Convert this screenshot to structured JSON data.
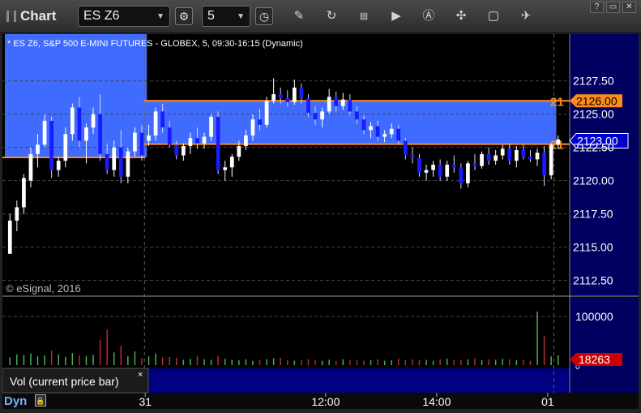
{
  "toolbar": {
    "title": "Chart",
    "symbol": "ES Z6",
    "interval": "5"
  },
  "chart_header": "* ES Z6, S&P 500 E-MINI FUTURES - GLOBEX, 5, 09:30-16:15 (Dynamic)",
  "copyright": "© eSignal, 2016",
  "volume_panel_label": "Vol (current price bar)",
  "volume_panel_close": "×",
  "footer_label": "Dyn",
  "colors": {
    "background": "#000000",
    "axis_bg": "#000060",
    "up": "#ffffff",
    "down": "#1a1aff",
    "zone": "#3f6bff",
    "level_line": "#ff8c1a",
    "vol_up": "#4caf50",
    "vol_down": "#b03030"
  },
  "chart_data": [
    {
      "type": "candlestick",
      "price_axis": {
        "ticks": [
          "2127.50",
          "2125.00",
          "2122.50",
          "2120.00",
          "2117.50",
          "2115.00",
          "2112.50"
        ],
        "ylim": [
          2111.5,
          2129.8
        ]
      },
      "time_axis": {
        "ticks": [
          "31",
          "12:00",
          "14:00",
          "01"
        ]
      },
      "levels": [
        {
          "value": 2126.0,
          "label": "2126.00",
          "edge_label": "21"
        },
        {
          "value": 2122.75,
          "label": "",
          "edge_label": "21"
        }
      ],
      "last_price": {
        "value": 2123.0,
        "label": "2123.00"
      },
      "prior_session_level": 2121.75,
      "zones": [
        {
          "from_bar": 0,
          "to_bar": 19,
          "low": 2121.75,
          "high": 2129.8
        },
        {
          "from_bar": 20,
          "to_bar": 78,
          "low": 2122.75,
          "high": 2126.0
        }
      ],
      "session_breaks": [
        20,
        79
      ],
      "bars": [
        [
          2114.5,
          2117.5,
          2114.5,
          2117.0
        ],
        [
          2117.0,
          2118.5,
          2116.2,
          2118.0
        ],
        [
          2118.0,
          2120.5,
          2117.5,
          2120.2
        ],
        [
          2120.0,
          2122.5,
          2119.5,
          2122.0
        ],
        [
          2122.0,
          2123.5,
          2121.0,
          2122.7
        ],
        [
          2122.7,
          2125.0,
          2122.5,
          2124.5
        ],
        [
          2124.5,
          2124.8,
          2120.2,
          2120.8
        ],
        [
          2120.8,
          2121.8,
          2120.3,
          2121.5
        ],
        [
          2121.5,
          2124.0,
          2121.0,
          2123.5
        ],
        [
          2123.5,
          2125.8,
          2123.0,
          2125.5
        ],
        [
          2125.5,
          2126.3,
          2122.5,
          2123.0
        ],
        [
          2123.0,
          2124.3,
          2121.3,
          2124.0
        ],
        [
          2124.0,
          2125.5,
          2123.5,
          2125.0
        ],
        [
          2125.0,
          2126.5,
          2121.5,
          2122.0
        ],
        [
          2122.0,
          2122.8,
          2120.5,
          2120.8
        ],
        [
          2120.8,
          2123.0,
          2120.3,
          2122.5
        ],
        [
          2122.5,
          2123.8,
          2119.8,
          2120.3
        ],
        [
          2120.3,
          2122.5,
          2119.8,
          2122.2
        ],
        [
          2122.2,
          2124.0,
          2121.8,
          2123.6
        ],
        [
          2123.6,
          2124.2,
          2121.5,
          2121.9
        ],
        [
          2123.0,
          2124.2,
          2122.6,
          2123.4
        ],
        [
          2123.4,
          2125.5,
          2123.0,
          2125.2
        ],
        [
          2125.2,
          2125.8,
          2123.6,
          2124.0
        ],
        [
          2124.0,
          2124.5,
          2122.5,
          2122.7
        ],
        [
          2122.7,
          2123.0,
          2121.6,
          2121.9
        ],
        [
          2121.9,
          2122.8,
          2121.5,
          2122.6
        ],
        [
          2122.6,
          2123.6,
          2122.0,
          2123.2
        ],
        [
          2123.2,
          2124.0,
          2122.4,
          2122.8
        ],
        [
          2122.8,
          2123.6,
          2122.4,
          2123.3
        ],
        [
          2123.3,
          2125.0,
          2123.0,
          2124.8
        ],
        [
          2124.8,
          2125.2,
          2120.5,
          2120.8
        ],
        [
          2120.8,
          2121.5,
          2120.0,
          2121.0
        ],
        [
          2121.0,
          2122.0,
          2120.3,
          2121.8
        ],
        [
          2121.8,
          2123.0,
          2121.5,
          2122.6
        ],
        [
          2122.6,
          2123.8,
          2122.3,
          2123.4
        ],
        [
          2123.4,
          2125.0,
          2123.0,
          2124.6
        ],
        [
          2124.6,
          2125.4,
          2123.8,
          2124.2
        ],
        [
          2124.2,
          2126.3,
          2124.0,
          2126.0
        ],
        [
          2126.0,
          2127.7,
          2125.8,
          2126.5
        ],
        [
          2126.5,
          2127.0,
          2125.8,
          2126.2
        ],
        [
          2126.2,
          2126.8,
          2125.6,
          2125.9
        ],
        [
          2125.9,
          2127.6,
          2125.7,
          2127.0
        ],
        [
          2127.0,
          2127.3,
          2125.8,
          2126.2
        ],
        [
          2126.2,
          2126.5,
          2124.8,
          2125.1
        ],
        [
          2125.1,
          2125.6,
          2124.2,
          2124.6
        ],
        [
          2124.6,
          2125.5,
          2124.0,
          2125.2
        ],
        [
          2125.2,
          2126.9,
          2125.0,
          2126.3
        ],
        [
          2126.3,
          2126.7,
          2125.2,
          2125.6
        ],
        [
          2125.6,
          2126.6,
          2125.3,
          2126.1
        ],
        [
          2126.1,
          2126.5,
          2124.9,
          2125.2
        ],
        [
          2125.2,
          2125.6,
          2124.3,
          2124.6
        ],
        [
          2124.6,
          2124.9,
          2123.5,
          2123.8
        ],
        [
          2123.8,
          2124.4,
          2123.2,
          2124.1
        ],
        [
          2124.1,
          2124.5,
          2123.0,
          2123.3
        ],
        [
          2123.3,
          2123.8,
          2122.9,
          2123.5
        ],
        [
          2123.5,
          2124.3,
          2123.2,
          2123.9
        ],
        [
          2123.9,
          2124.2,
          2122.7,
          2123.0
        ],
        [
          2123.0,
          2123.2,
          2121.6,
          2121.9
        ],
        [
          2121.9,
          2122.5,
          2121.3,
          2121.7
        ],
        [
          2121.7,
          2122.0,
          2120.3,
          2120.6
        ],
        [
          2120.6,
          2121.2,
          2120.0,
          2120.8
        ],
        [
          2120.8,
          2121.5,
          2120.3,
          2121.2
        ],
        [
          2121.2,
          2121.6,
          2120.0,
          2120.3
        ],
        [
          2120.3,
          2121.5,
          2120.0,
          2121.2
        ],
        [
          2121.2,
          2121.9,
          2120.6,
          2121.0
        ],
        [
          2121.0,
          2121.3,
          2119.4,
          2119.8
        ],
        [
          2119.8,
          2121.5,
          2119.5,
          2121.3
        ],
        [
          2121.3,
          2122.0,
          2120.8,
          2121.1
        ],
        [
          2121.1,
          2122.2,
          2120.9,
          2122.0
        ],
        [
          2122.0,
          2122.5,
          2121.2,
          2121.5
        ],
        [
          2121.5,
          2122.3,
          2121.2,
          2121.9
        ],
        [
          2121.9,
          2122.7,
          2121.6,
          2122.4
        ],
        [
          2122.4,
          2122.8,
          2121.2,
          2121.5
        ],
        [
          2121.5,
          2122.6,
          2121.0,
          2122.3
        ],
        [
          2122.3,
          2122.7,
          2121.6,
          2121.8
        ],
        [
          2121.8,
          2122.3,
          2121.4,
          2121.6
        ],
        [
          2121.6,
          2122.4,
          2121.1,
          2122.1
        ],
        [
          2122.1,
          2122.6,
          2119.6,
          2120.4
        ],
        [
          2120.4,
          2122.8,
          2120.1,
          2122.7
        ],
        [
          2122.7,
          2123.4,
          2122.4,
          2123.1
        ]
      ],
      "volume_axis": {
        "ticks": [
          "100000",
          "0"
        ],
        "max": 130000
      },
      "last_volume": {
        "value": 18263,
        "label": "18263"
      },
      "volume": [
        16000,
        22000,
        21000,
        24000,
        18000,
        20000,
        30000,
        22000,
        17000,
        25000,
        20000,
        19000,
        21000,
        52000,
        73000,
        26000,
        40000,
        18000,
        28000,
        14000,
        18000,
        24000,
        16000,
        17000,
        15000,
        11000,
        13000,
        19000,
        12000,
        11000,
        19000,
        13000,
        11000,
        10000,
        12000,
        9000,
        10000,
        12000,
        14000,
        15000,
        10000,
        9000,
        11000,
        12000,
        10000,
        9000,
        11000,
        8000,
        12000,
        10000,
        11000,
        9000,
        10000,
        12000,
        9000,
        10000,
        13000,
        11000,
        12000,
        10000,
        11000,
        9000,
        12000,
        13000,
        11000,
        10000,
        12000,
        14000,
        10000,
        12000,
        11000,
        13000,
        12000,
        10000,
        11000,
        9000,
        110000,
        60000,
        18000,
        20000
      ]
    }
  ]
}
